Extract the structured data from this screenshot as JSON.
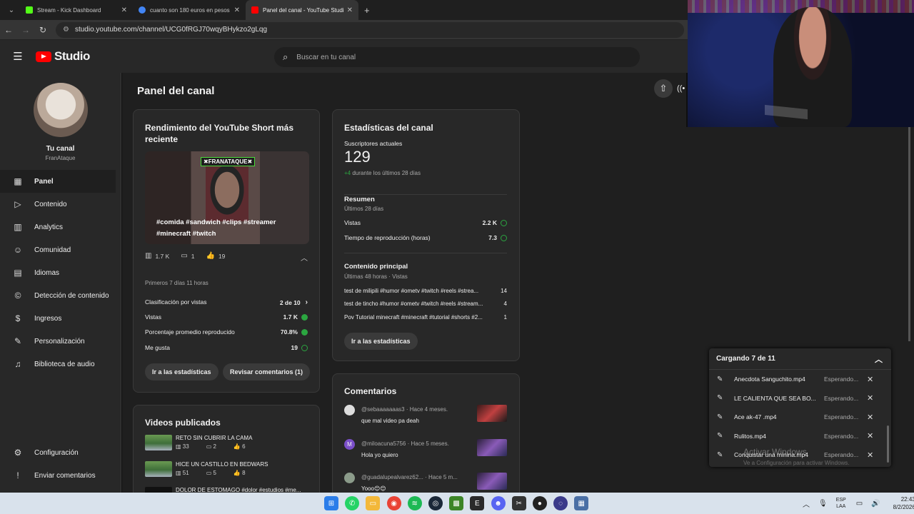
{
  "browser": {
    "tabs": [
      {
        "title": "Stream - Kick Dashboard",
        "favicon_color": "#53fc18",
        "active": false
      },
      {
        "title": "cuanto son 180 euros en pesos",
        "favicon_color": "#4285f4",
        "active": false
      },
      {
        "title": "Panel del canal - YouTube Studio",
        "favicon_color": "#ff0000",
        "active": true
      }
    ],
    "url": "studio.youtube.com/channel/UCG0fRGJ70wqyBHykzo2gLqg"
  },
  "header": {
    "logo_text": "Studio",
    "search_placeholder": "Buscar en tu canal"
  },
  "sidebar": {
    "channel_title": "Tu canal",
    "channel_handle": "FranAtaque",
    "items": [
      {
        "label": "Panel",
        "icon": "dashboard-icon",
        "glyph": "▦"
      },
      {
        "label": "Contenido",
        "icon": "content-icon",
        "glyph": "▷"
      },
      {
        "label": "Analytics",
        "icon": "analytics-icon",
        "glyph": "▥"
      },
      {
        "label": "Comunidad",
        "icon": "community-icon",
        "glyph": "☺"
      },
      {
        "label": "Idiomas",
        "icon": "subtitles-icon",
        "glyph": "▤"
      },
      {
        "label": "Detección de contenido",
        "icon": "copyright-icon",
        "glyph": "©"
      },
      {
        "label": "Ingresos",
        "icon": "earn-icon",
        "glyph": "$"
      },
      {
        "label": "Personalización",
        "icon": "customize-icon",
        "glyph": "✎"
      },
      {
        "label": "Biblioteca de audio",
        "icon": "audio-library-icon",
        "glyph": "♫"
      }
    ],
    "bottom_items": [
      {
        "label": "Configuración",
        "icon": "settings-icon",
        "glyph": "⚙"
      },
      {
        "label": "Enviar comentarios",
        "icon": "feedback-icon",
        "glyph": "!"
      }
    ]
  },
  "main": {
    "page_title": "Panel del canal",
    "short_card": {
      "title": "Rendimiento del YouTube Short más reciente",
      "thumb_tag": "✖FRANATAQUE✖",
      "thumb_caption": "#comida #sandwich #clips #streamer #minecraft #twitch",
      "views": "1.7 K",
      "comments": "1",
      "likes": "19",
      "period": "Primeros 7 días 11 horas",
      "rows": [
        {
          "label": "Clasificación por vistas",
          "value": "2 de 10",
          "mark": "chevron"
        },
        {
          "label": "Vistas",
          "value": "1.7 K",
          "mark": "up"
        },
        {
          "label": "Porcentaje promedio reproducido",
          "value": "70.8%",
          "mark": "up"
        },
        {
          "label": "Me gusta",
          "value": "19",
          "mark": "check"
        }
      ],
      "btn_stats": "Ir a las estadísticas",
      "btn_comments": "Revisar comentarios (1)"
    },
    "videos_card": {
      "title": "Videos publicados",
      "items": [
        {
          "title": "RETO SIN CUBRIR LA CAMA",
          "views": "33",
          "comments": "2",
          "likes": "6"
        },
        {
          "title": "HICE UN CASTILLO EN BEDWARS",
          "views": "51",
          "comments": "5",
          "likes": "8"
        },
        {
          "title": "DOLOR DE ESTOMAGO #dolor #estudios #me..."
        }
      ]
    },
    "stats_card": {
      "title": "Estadísticas del canal",
      "subs_label": "Suscriptores actuales",
      "subs_value": "129",
      "subs_delta": "+4",
      "subs_delta_text": "durante los últimos 28 días",
      "summary_title": "Resumen",
      "summary_period": "Últimos 28 días",
      "summary_rows": [
        {
          "label": "Vistas",
          "value": "2.2 K"
        },
        {
          "label": "Tiempo de reproducción (horas)",
          "value": "7.3"
        }
      ],
      "top_title": "Contenido principal",
      "top_period": "Últimas 48 horas · Vistas",
      "top_rows": [
        {
          "title": "test de milipili #humor #ometv #twitch #reels #strea...",
          "value": "14"
        },
        {
          "title": "test de tincho #humor #ometv #twitch #reels #stream...",
          "value": "4"
        },
        {
          "title": "Pov Tutorial minecraft #minecraft #tutorial #shorts #2...",
          "value": "1"
        }
      ],
      "btn_stats": "Ir a las estadísticas"
    },
    "comments_card": {
      "title": "Comentarios",
      "items": [
        {
          "author": "@sebaaaaaaas3",
          "time": "Hace 4 meses.",
          "text": "que mal video pa deah",
          "avatar_color": "#dddddd"
        },
        {
          "author": "@miloacuna5756",
          "time": "Hace 5 meses.",
          "text": "Hola yo quiero",
          "avatar_color": "#7b4fc9",
          "initial": "M"
        },
        {
          "author": "@guadalupealvarez62...",
          "time": "Hace 5 m...",
          "text": "Yooo😊😊",
          "avatar_color": "#8b9b8a"
        }
      ]
    }
  },
  "uploads": {
    "title": "Cargando 7 de 11",
    "items": [
      {
        "name": "Anecdota Sanguchito.mp4",
        "status": "Esperando..."
      },
      {
        "name": "LE CALIENTA QUE SEA BO...",
        "status": "Esperando..."
      },
      {
        "name": "Ace ak-47 .mp4",
        "status": "Esperando..."
      },
      {
        "name": "Rulitos.mp4",
        "status": "Esperando..."
      },
      {
        "name": "Conquistar una minina.mp4",
        "status": "Esperando..."
      }
    ]
  },
  "windows_watermark": {
    "line1": "Activar Windows",
    "line2": "Ve a Configuración para activar Windows."
  },
  "taskbar": {
    "lang_top": "ESP",
    "lang_bottom": "LAA",
    "time": "22:43",
    "date": "8/2/2026"
  }
}
